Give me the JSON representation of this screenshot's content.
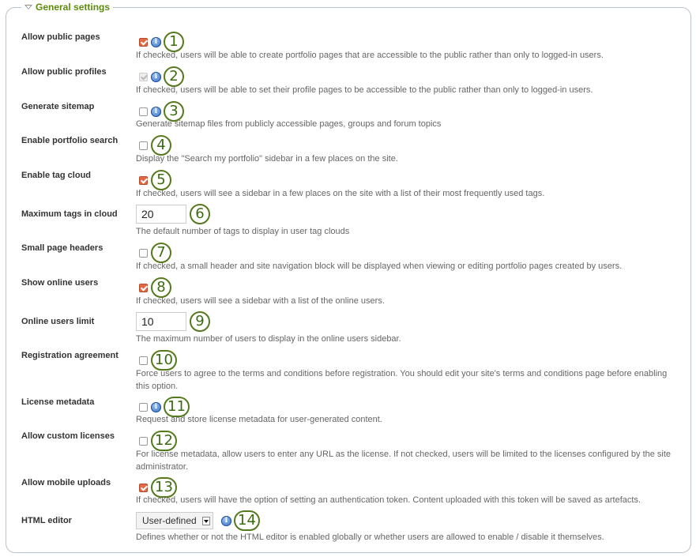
{
  "section": {
    "title": "General settings",
    "collapse_icon": "triangle-down-icon"
  },
  "settings": [
    {
      "label": "Allow public pages",
      "control": "checkbox",
      "checked": true,
      "disabled": false,
      "info": true,
      "callout": "1",
      "description": "If checked, users will be able to create portfolio pages that are accessible to the public rather than only to logged-in users."
    },
    {
      "label": "Allow public profiles",
      "control": "checkbox",
      "checked": true,
      "disabled": true,
      "info": true,
      "callout": "2",
      "description": "If checked, users will be able to set their profile pages to be accessible to the public rather than only to logged-in users."
    },
    {
      "label": "Generate sitemap",
      "control": "checkbox",
      "checked": false,
      "disabled": false,
      "info": true,
      "callout": "3",
      "description": "Generate sitemap files from publicly accessible pages, groups and forum topics"
    },
    {
      "label": "Enable portfolio search",
      "control": "checkbox",
      "checked": false,
      "disabled": false,
      "info": false,
      "callout": "4",
      "description": "Display the \"Search my portfolio\" sidebar in a few places on the site."
    },
    {
      "label": "Enable tag cloud",
      "control": "checkbox",
      "checked": true,
      "disabled": false,
      "info": false,
      "callout": "5",
      "description": "If checked, users will see a sidebar in a few places on the site with a list of their most frequently used tags."
    },
    {
      "label": "Maximum tags in cloud",
      "control": "text",
      "value": "20",
      "info": false,
      "callout": "6",
      "description": "The default number of tags to display in user tag clouds"
    },
    {
      "label": "Small page headers",
      "control": "checkbox",
      "checked": false,
      "disabled": false,
      "info": false,
      "callout": "7",
      "description": "If checked, a small header and site navigation block will be displayed when viewing or editing portfolio pages created by users."
    },
    {
      "label": "Show online users",
      "control": "checkbox",
      "checked": true,
      "disabled": false,
      "info": false,
      "callout": "8",
      "description": "If checked, users will see a sidebar with a list of the online users."
    },
    {
      "label": "Online users limit",
      "control": "text",
      "value": "10",
      "info": false,
      "callout": "9",
      "description": "The maximum number of users to display in the online users sidebar."
    },
    {
      "label": "Registration agreement",
      "control": "checkbox",
      "checked": false,
      "disabled": false,
      "info": false,
      "callout": "10",
      "description": "Force users to agree to the terms and conditions before registration. You should edit your site's terms and conditions page before enabling this option."
    },
    {
      "label": "License metadata",
      "control": "checkbox",
      "checked": false,
      "disabled": false,
      "info": true,
      "callout": "11",
      "description": "Request and store license metadata for user-generated content."
    },
    {
      "label": "Allow custom licenses",
      "control": "checkbox",
      "checked": false,
      "disabled": false,
      "info": false,
      "callout": "12",
      "description": "For license metadata, allow users to enter any URL as the license. If not checked, users will be limited to the licenses configured by the site administrator."
    },
    {
      "label": "Allow mobile uploads",
      "control": "checkbox",
      "checked": true,
      "disabled": false,
      "info": false,
      "callout": "13",
      "description": "If checked, users will have the option of setting an authentication token. Content uploaded with this token will be saved as artefacts."
    },
    {
      "label": "HTML editor",
      "control": "select",
      "value": "User-defined",
      "info": true,
      "callout": "14",
      "description": "Defines whether or not the HTML editor is enabled globally or whether users are allowed to enable / disable it themselves."
    }
  ],
  "icons": {
    "info": "i"
  },
  "colors": {
    "legend": "#5d8a0b",
    "checked": "#e06a45",
    "callout_border": "#557a1d"
  }
}
